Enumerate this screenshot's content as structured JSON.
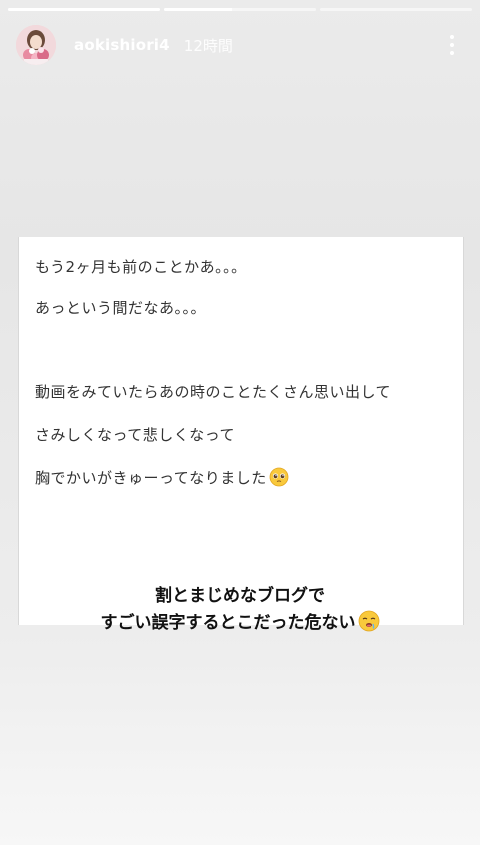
{
  "story": {
    "segments": [
      {
        "progress": 1.0
      },
      {
        "progress": 0.45
      },
      {
        "progress": 0.0
      }
    ],
    "user": {
      "username": "aokishiori4",
      "time_ago": "12時間"
    },
    "icons": {
      "more": "more-vertical-icon",
      "pleading_face": "pleading-face-emoji",
      "sweat_face": "drooling-face-emoji"
    },
    "post": {
      "lines": [
        "もう2ヶ月も前のことかあ。。。",
        "あっという間だなあ。。。",
        "動画をみていたらあの時のことたくさん思い出して",
        "さみしくなって悲しくなって",
        "胸でかいがきゅーってなりました"
      ]
    },
    "caption": {
      "line1": "割とまじめなブログで",
      "line2": "すごい誤字するとこだった危ない"
    },
    "colors": {
      "background": "#e9e9e9",
      "card": "#ffffff",
      "text": "#333333",
      "header_text": "#ffffff"
    }
  }
}
